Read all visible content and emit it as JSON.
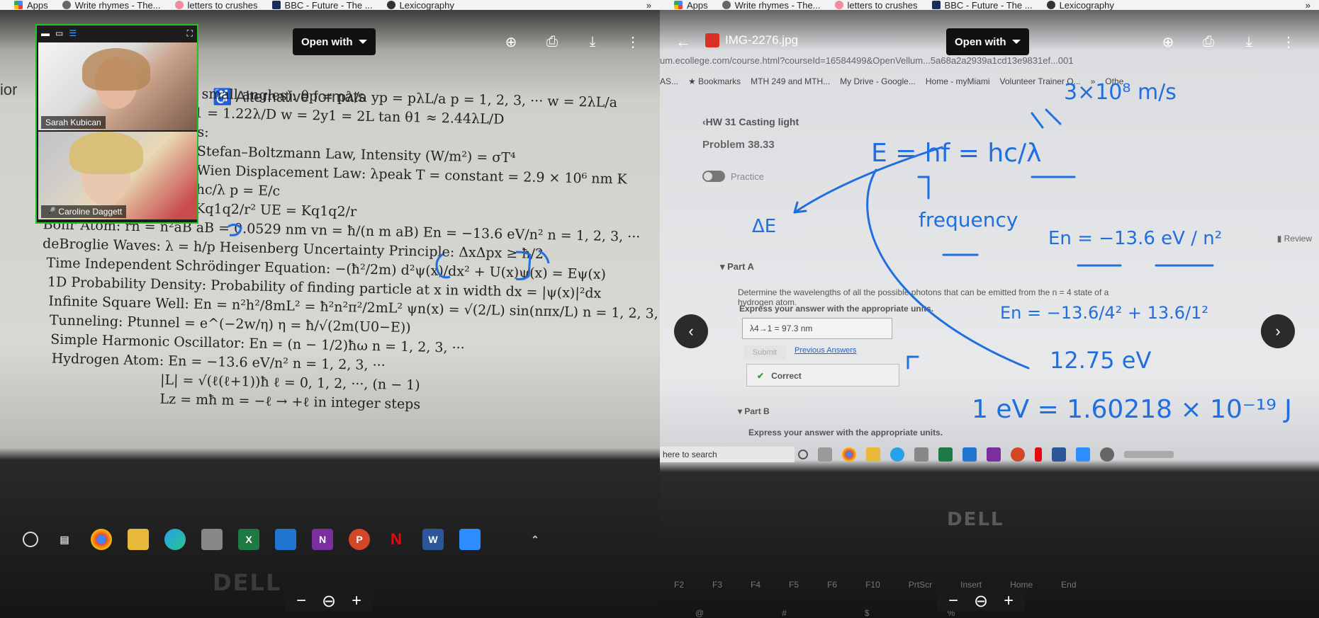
{
  "bookmarks_bar": {
    "items": [
      {
        "label": "Apps",
        "icon": "apps-grid-icon"
      },
      {
        "label": "Write rhymes - The...",
        "icon": "globe-icon"
      },
      {
        "label": "letters to crushes",
        "icon": "heart-icon"
      },
      {
        "label": "BBC - Future - The ...",
        "icon": "bbc-icon"
      },
      {
        "label": "Lexicography",
        "icon": "dictionary-icon"
      }
    ],
    "more": "»"
  },
  "left_viewer": {
    "open_with": "Open with",
    "notes": {
      "alt_formats": "Alternative formats",
      "lines": [
        "small angles):  θp = pλ/a   yp = pλL/a   p = 1, 2, 3, ···   w = 2λL/a",
        "1 = 1.22λ/D   w = 2y1 = 2L tan θ1 ≈ 2.44λL/D",
        "s:",
        "Stefan–Boltzmann Law, Intensity (W/m²) = σT⁴",
        "Wien Displacement Law:  λpeak T = constant = 2.9 × 10⁶ nm K",
        "hc/λ   p = E/c",
        "Coulomb Force:  FE = Kq1q2/r²    UE = Kq1q2/r",
        "Bohr Atom:  rn = n²aB   aB = 0.0529 nm   vn = ħ/(n m aB)   En = −13.6 eV/n²   n = 1, 2, 3, ···",
        "deBroglie Waves:  λ = h/p     Heisenberg Uncertainty Principle:  ΔxΔpx ≥ ħ/2",
        "Time Independent Schrödinger Equation:   −(ħ²/2m) d²ψ(x)/dx² + U(x)ψ(x) = Eψ(x)",
        "1D Probability Density: Probability of finding particle at x in width dx = |ψ(x)|²dx",
        "Infinite Square Well:   En = n²h²/8mL² = ħ²n²π²/2mL²   ψn(x) = √(2/L) sin(nπx/L)   n = 1, 2, 3, ···",
        "Tunneling:  Ptunnel = e^(−2w/η)    η = ħ/√(2m(U0−E))",
        "Simple Harmonic Oscillator:  En = (n − 1/2)ħω     n = 1, 2, 3, ···",
        "Hydrogen Atom:   En = −13.6 eV/n²    n = 1, 2, 3, ···",
        "|L| = √(ℓ(ℓ+1))ħ    ℓ = 0, 1, 2, ···, (n − 1)",
        "Lz = mħ    m = −ℓ → +ℓ in integer steps"
      ]
    },
    "video": {
      "participants": [
        {
          "name": "Sarah Kubican"
        },
        {
          "name": "Caroline Daggett"
        }
      ]
    },
    "taskbar_icons": [
      "start-circle-icon",
      "task-view-icon",
      "chrome-icon",
      "file-explorer-icon",
      "edge-icon",
      "store-icon",
      "excel-icon",
      "mail-icon",
      "onenote-icon",
      "powerpoint-icon",
      "netflix-icon",
      "word-icon",
      "zoom-icon"
    ],
    "taskbar_labels": {
      "excel": "X",
      "onenote": "N",
      "powerpoint": "P",
      "netflix": "N",
      "word": "W"
    },
    "brand": "DELL",
    "zoom_controls": {
      "minus": "−",
      "zoom": "⊖",
      "plus": "+"
    }
  },
  "right_viewer": {
    "file_name": "IMG-2276.jpg",
    "open_with": "Open with",
    "photo": {
      "url_text": "um.ecollege.com/course.html?courseId=16584499&OpenVellum...5a68a2a2939a1cd13e9831ef...001",
      "web_bookmarks": [
        "AS...",
        "★ Bookmarks",
        "MTH 249 and MTH...",
        "My Drive - Google...",
        "Home - myMiami",
        "Volunteer Trainer O...",
        "»",
        "Othe"
      ],
      "hw_link": "‹HW 31 Casting light",
      "problem": "Problem 38.33",
      "practice": "Practice",
      "review": "Review",
      "part_a": "Part A",
      "question": "Determine the wavelengths of all the possible photons that can be emitted from the n = 4 state of a hydrogen atom.",
      "express": "Express your answer with the appropriate units.",
      "answer": "λ4→1 =  97.3 nm",
      "submit": "Submit",
      "previous_answers": "Previous Answers",
      "correct": "Correct",
      "part_b": "Part B",
      "express_b": "Express your answer with the appropriate units.",
      "search": "here to search",
      "brand": "DELL",
      "keys_row1": [
        "F2",
        "F3",
        "F4",
        "F5",
        "F6",
        "F10",
        "PrtScr",
        "Insert",
        "Home",
        "End"
      ],
      "keys_row2": [
        "@",
        "#",
        "$",
        "%"
      ]
    },
    "handwriting": [
      "3×10⁸ m/s",
      "E = hf = hc/λ",
      "ΔE",
      "frequency",
      "En = −13.6 eV / n²",
      "En = −13.6/4² + 13.6/1²",
      "12.75 eV",
      "1 eV = 1.60218 × 10⁻¹⁹ J"
    ],
    "zoom_controls": {
      "minus": "−",
      "zoom": "⊖",
      "plus": "+"
    }
  },
  "colors": {
    "ink": "#1f6fe0",
    "zoom_border": "#25c225",
    "link": "#2a62b8"
  }
}
